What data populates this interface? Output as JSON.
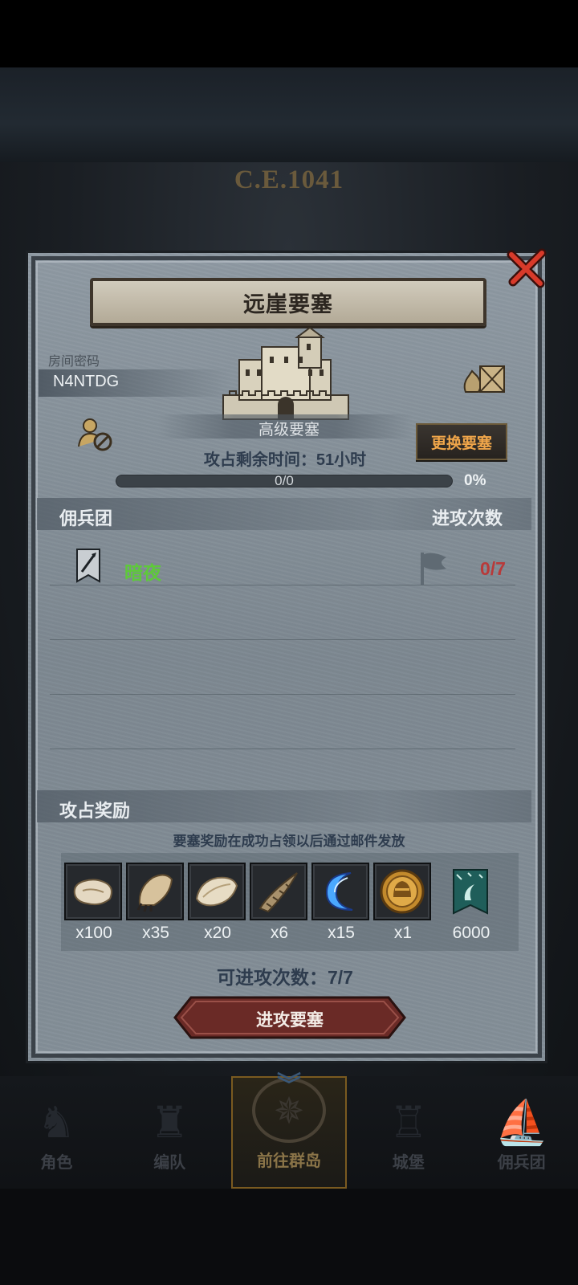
{
  "background": {
    "year": "C.E.1041"
  },
  "dialog": {
    "title": "远崖要塞",
    "room": {
      "label": "房间密码",
      "code": "N4NTDG"
    },
    "fortress_name": "高级要塞",
    "change_button": "更换要塞",
    "remaining_time": "攻占剩余时间：51小时",
    "progress": {
      "text": "0/0",
      "percent": "0%",
      "fraction": 0
    },
    "mercenary_section": {
      "title": "佣兵团",
      "count_title": "进攻次数",
      "rows": [
        {
          "name": "暗夜",
          "attacks": "0/7"
        }
      ]
    },
    "rewards_section": {
      "title": "攻占奖励",
      "note": "要塞奖励在成功占领以后通过邮件发放",
      "items": [
        {
          "icon": "hide-icon",
          "qty": "x100"
        },
        {
          "icon": "claw-pelt-icon",
          "qty": "x35"
        },
        {
          "icon": "fur-icon",
          "qty": "x20"
        },
        {
          "icon": "horn-icon",
          "qty": "x6"
        },
        {
          "icon": "crescent-moon-icon",
          "qty": "x15"
        },
        {
          "icon": "helmet-coin-icon",
          "qty": "x1"
        },
        {
          "icon": "guild-banner-icon",
          "qty": "6000"
        }
      ]
    },
    "attacks_left": "可进攻次数：7/7",
    "attack_button": "进攻要塞"
  },
  "bottom_nav": [
    {
      "label": "角色",
      "icon": "knight-icon",
      "active": false
    },
    {
      "label": "编队",
      "icon": "team-icon",
      "active": false
    },
    {
      "label": "前往群岛",
      "icon": "compass-icon",
      "active": true
    },
    {
      "label": "城堡",
      "icon": "castle-icon",
      "active": false
    },
    {
      "label": "佣兵团",
      "icon": "ship-icon",
      "active": false
    }
  ],
  "colors": {
    "accent_orange": "#f0a64a",
    "merc_green": "#5ec93a",
    "count_red": "#b83a3a",
    "close_red": "#d83a2a"
  }
}
